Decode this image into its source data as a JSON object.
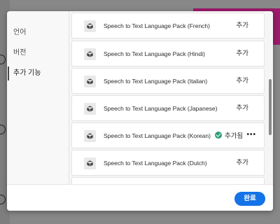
{
  "sidebar": {
    "items": [
      {
        "label": "언어"
      },
      {
        "label": "버전"
      },
      {
        "label": "추가 기능"
      }
    ]
  },
  "packages": [
    {
      "name": "Speech to Text Language Pack (French)",
      "action": "추가"
    },
    {
      "name": "Speech to Text Language Pack (Hindi)",
      "action": "추가"
    },
    {
      "name": "Speech to Text Language Pack (Italian)",
      "action": "추가"
    },
    {
      "name": "Speech to Text Language Pack (Japanese)",
      "action": "추가"
    },
    {
      "name": "Speech to Text Language Pack (Korean)",
      "status": "추가됨"
    },
    {
      "name": "Speech to Text Language Pack (Dutch)",
      "action": "추가"
    }
  ],
  "footer": {
    "done_label": "완료"
  },
  "colors": {
    "primary": "#1473e6",
    "installed": "#2d9d78",
    "background_accent": "#9b1a6a"
  }
}
